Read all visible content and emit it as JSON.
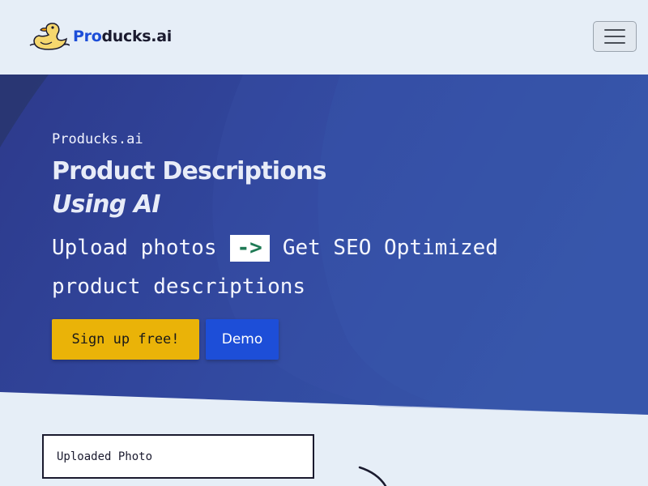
{
  "brand": {
    "name_accent": "Pro",
    "name_rest": "ducks.ai",
    "logo_icon": "duck-icon"
  },
  "nav": {
    "menu_icon": "hamburger-menu-icon"
  },
  "hero": {
    "eyebrow": "Producks.ai",
    "title": "Product Descriptions",
    "title_emphasis": "Using AI",
    "line1_start": "Upload photos",
    "arrow": "->",
    "line1_end": "Get SEO Optimized",
    "line2": "product descriptions",
    "signup_label": "Sign up free!",
    "demo_label": "Demo"
  },
  "upload": {
    "label": "Uploaded Photo"
  },
  "colors": {
    "accent_blue": "#1d4ed8",
    "cta_yellow": "#eab308",
    "hero_from": "#2e3f8f",
    "hero_to": "#3453a6",
    "page_bg": "#e6eef7"
  }
}
